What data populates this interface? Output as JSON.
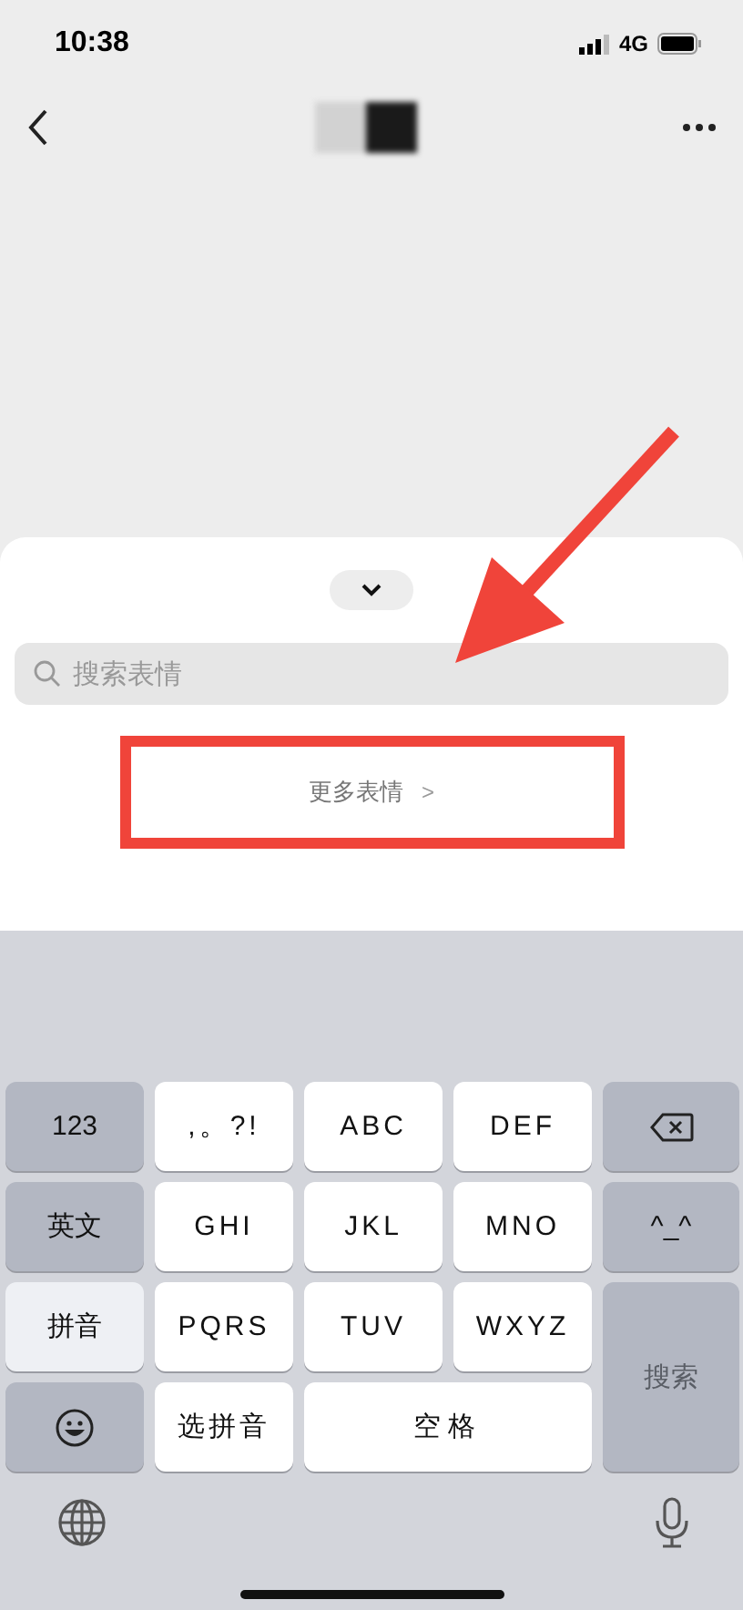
{
  "status_bar": {
    "time": "10:38",
    "network": "4G"
  },
  "sheet": {
    "search": {
      "placeholder": "搜索表情"
    },
    "more_button": {
      "label": "更多表情",
      "chevron": ">",
      "highlighted": true
    }
  },
  "keyboard": {
    "keys": [
      {
        "kind": "function",
        "label": "123"
      },
      {
        "kind": "letter",
        "label": ",。?!"
      },
      {
        "kind": "letter",
        "label": "ABC"
      },
      {
        "kind": "letter",
        "label": "DEF"
      },
      {
        "kind": "delete"
      },
      {
        "kind": "function",
        "label": "英文"
      },
      {
        "kind": "letter",
        "label": "GHI"
      },
      {
        "kind": "letter",
        "label": "JKL"
      },
      {
        "kind": "letter",
        "label": "MNO"
      },
      {
        "kind": "function",
        "label": "^_^"
      },
      {
        "kind": "function",
        "label": "拼音",
        "selected": true
      },
      {
        "kind": "letter",
        "label": "PQRS"
      },
      {
        "kind": "letter",
        "label": "TUV"
      },
      {
        "kind": "letter",
        "label": "WXYZ"
      },
      {
        "kind": "action",
        "label": "搜索",
        "disabled": true
      },
      {
        "kind": "emoji"
      },
      {
        "kind": "letter",
        "label": "选拼音"
      },
      {
        "kind": "space",
        "label": "空格"
      }
    ]
  }
}
